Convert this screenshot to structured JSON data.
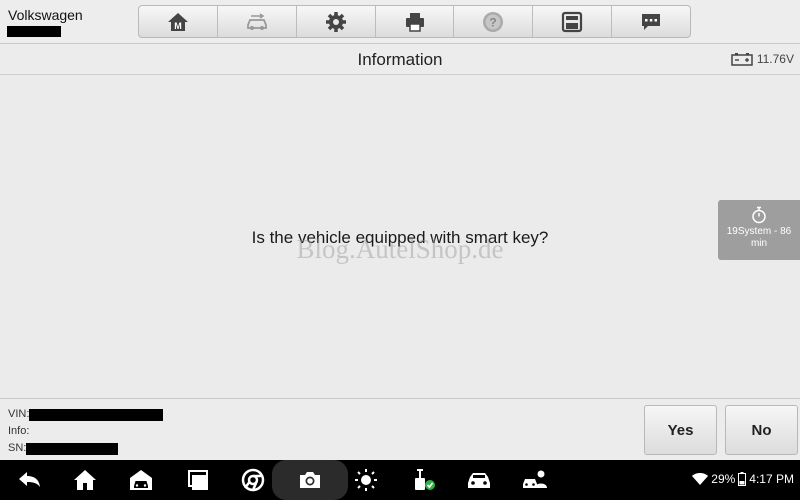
{
  "header": {
    "brand": "Volkswagen",
    "toolbar": [
      {
        "name": "home-icon"
      },
      {
        "name": "vehicle-swap-icon"
      },
      {
        "name": "settings-icon"
      },
      {
        "name": "print-icon"
      },
      {
        "name": "help-icon"
      },
      {
        "name": "save-icon"
      },
      {
        "name": "message-icon"
      }
    ]
  },
  "titlebar": {
    "title": "Information",
    "voltage": "11.76V"
  },
  "main": {
    "question": "Is the vehicle equipped with smart key?",
    "watermark": "Blog.AutelShop.de",
    "timer_label": "19System - 86 min"
  },
  "footer": {
    "vin_label": "VIN:",
    "info_label": "Info:",
    "sn_label": "SN:",
    "yes_label": "Yes",
    "no_label": "No"
  },
  "status": {
    "battery": "29%",
    "time": "4:17 PM"
  }
}
